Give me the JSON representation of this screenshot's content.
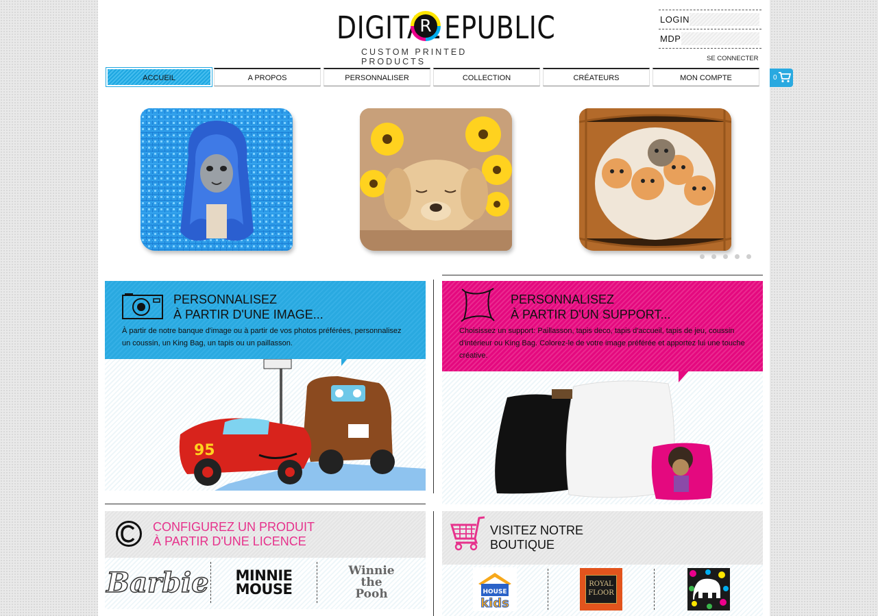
{
  "header": {
    "logo_left": "DIGITAL",
    "logo_r": "R",
    "logo_right": "EPUBLIC",
    "tagline": "CUSTOM PRINTED PRODUCTS"
  },
  "login": {
    "login_label": "LOGIN",
    "password_label": "MDP",
    "login_value": "",
    "password_value": "",
    "submit_label": "SE CONNECTER"
  },
  "nav": {
    "items": [
      {
        "label": "ACCUEIL",
        "active": true
      },
      {
        "label": "A PROPOS"
      },
      {
        "label": "PERSONNALISER"
      },
      {
        "label": "COLLECTION"
      },
      {
        "label": "CRÉATEURS"
      },
      {
        "label": "MON COMPTE"
      }
    ]
  },
  "cart": {
    "count": "0",
    "icon": "cart-icon"
  },
  "carousel": {
    "slides": [
      {
        "subject": "blue wig cat cushion"
      },
      {
        "subject": "sleeping puppy with daisies cushion"
      },
      {
        "subject": "kittens in basket cushion"
      }
    ],
    "dot_count": 5
  },
  "panels": {
    "image": {
      "title_line1": "PERSONNALISEZ",
      "title_line2": "À PARTIR D'UNE IMAGE...",
      "text": "À partir de notre banque d'image ou à partir de vos photos préférées, personnalisez un coussin, un King Bag, un tapis ou un paillasson.",
      "icon": "camera-icon",
      "color": "#29a9e0"
    },
    "support": {
      "title_line1": "PERSONNALISEZ",
      "title_line2": "À PARTIR D'UN SUPPORT...",
      "text": "Choisissez un support: Paillasson, tapis deco, tapis d'accueil, tapis de jeu, coussin d'intérieur ou King Bag. Colorez-le de votre image préférée et apportez lui une touche créative.",
      "icon": "cushion-icon",
      "color": "#e4097f"
    },
    "license": {
      "title_line1": "CONFIGUREZ UN PRODUIT",
      "title_line2": "À PARTIR D'UNE LICENCE",
      "icon": "copyright-icon",
      "color": "#e6328c",
      "brands": [
        "Barbie",
        "MINNIE MOUSE",
        "Winnie the Pooh"
      ]
    },
    "shop": {
      "title_line1": "VISITEZ NOTRE",
      "title_line2": "BOUTIQUE",
      "icon": "shopping-cart-icon",
      "brands": [
        "The House of Kids",
        "ROYAL FLOOR",
        "elephant pattern"
      ],
      "royal_line1": "ROYAL",
      "royal_line2": "FLOOR"
    }
  }
}
